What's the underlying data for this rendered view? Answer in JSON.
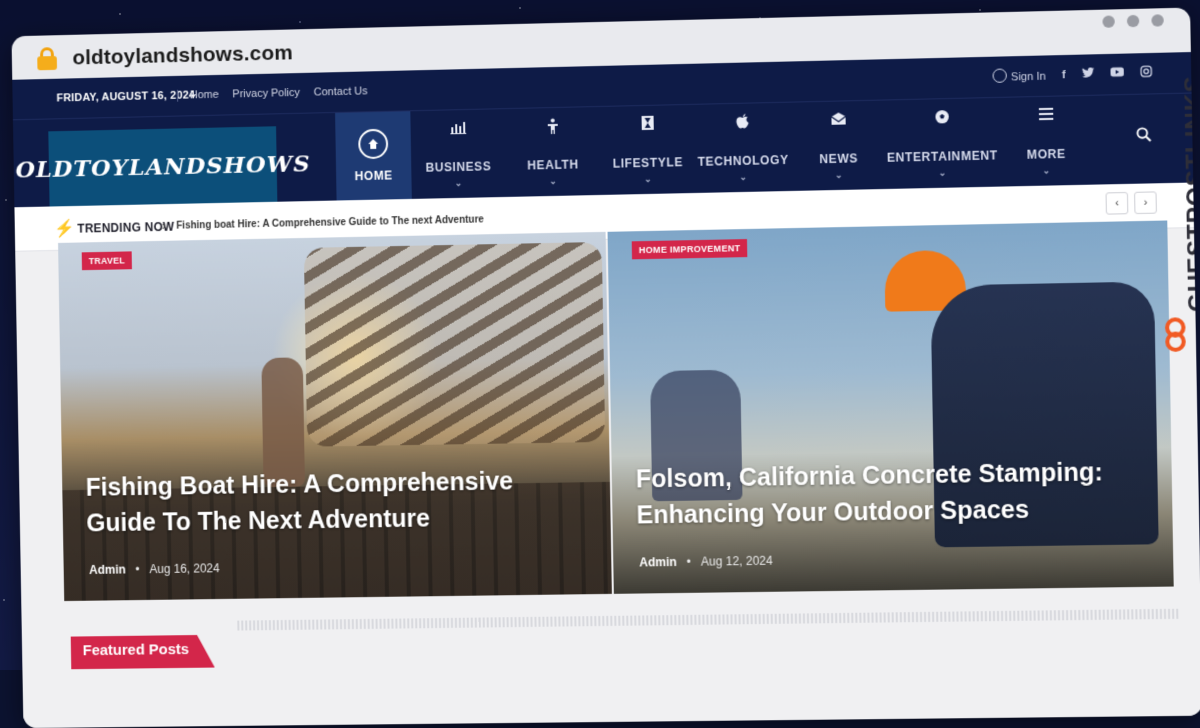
{
  "browser": {
    "url": "oldtoylandshows.com"
  },
  "topbar": {
    "date": "FRIDAY, AUGUST 16, 2024",
    "links": [
      "Home",
      "Privacy Policy",
      "Contact Us"
    ],
    "sign_in": "Sign In",
    "social": [
      "f-icon",
      "twitter-icon",
      "youtube-icon",
      "instagram-icon"
    ]
  },
  "logo": {
    "text": "OLDTOYLANDSHOWS"
  },
  "nav": {
    "items": [
      {
        "label": "HOME",
        "icon": "home-icon",
        "active": true
      },
      {
        "label": "BUSINESS",
        "icon": "chart-icon"
      },
      {
        "label": "HEALTH",
        "icon": "person-icon"
      },
      {
        "label": "LIFESTYLE",
        "icon": "hourglass-icon"
      },
      {
        "label": "TECHNOLOGY",
        "icon": "apple-icon"
      },
      {
        "label": "NEWS",
        "icon": "envelope-icon"
      },
      {
        "label": "ENTERTAINMENT",
        "icon": "soccer-ball-icon"
      },
      {
        "label": "MORE",
        "icon": "hamburger-icon"
      }
    ]
  },
  "trending": {
    "label": "TRENDING NOW",
    "headline": "Fishing boat Hire: A Comprehensive Guide to The next Adventure"
  },
  "hero": [
    {
      "tag": "TRAVEL",
      "title": "Fishing Boat Hire: A Comprehensive Guide To The Next Adventure",
      "author": "Admin",
      "date": "Aug 16, 2024"
    },
    {
      "tag": "HOME IMPROVEMENT",
      "title": "Folsom, California Concrete Stamping: Enhancing Your Outdoor Spaces",
      "author": "Admin",
      "date": "Aug 12, 2024"
    }
  ],
  "section": {
    "featured": "Featured Posts"
  },
  "watermark": {
    "text_dark": "GUESTPOSTLINKS"
  },
  "colors": {
    "accent": "#d3264a",
    "nav_bg": "#0e1b47",
    "logo_bg": "#0c4f7a"
  }
}
